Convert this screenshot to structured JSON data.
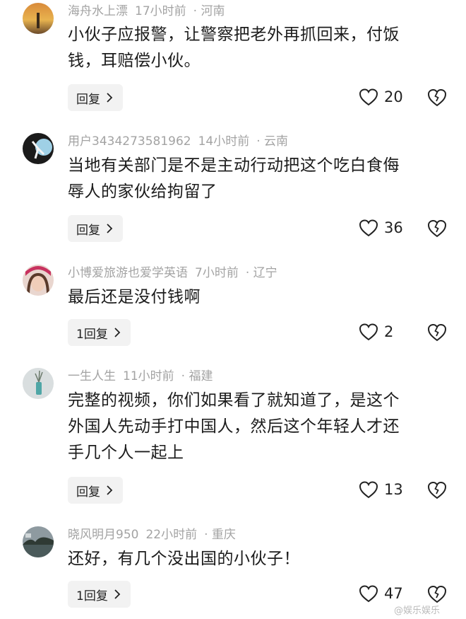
{
  "comments": [
    {
      "username": "海舟水上漂",
      "time": "17小时前",
      "location": "· 河南",
      "lines": [
        "小伙子应报警，让警察把老外再抓回来，付饭",
        "钱，耳赔偿小伙。"
      ],
      "reply_label": "回复",
      "likes": "20"
    },
    {
      "username": "用户3434273581962",
      "time": "14小时前",
      "location": "· 云南",
      "lines": [
        "当地有关部门是不是主动行动把这个吃白食侮",
        "辱人的家伙给拘留了"
      ],
      "reply_label": "回复",
      "likes": "36"
    },
    {
      "username": "小博爱旅游也爱学英语",
      "time": "7小时前",
      "location": "· 辽宁",
      "lines": [
        "最后还是没付钱啊"
      ],
      "reply_label": "1回复",
      "likes": "2"
    },
    {
      "username": "一生人生",
      "time": "11小时前",
      "location": "· 福建",
      "lines": [
        "完整的视频，你们如果看了就知道了，是这个",
        "外国人先动手打中国人，然后这个年轻人才还",
        "手几个人一起上"
      ],
      "reply_label": "回复",
      "likes": "13"
    },
    {
      "username": "晓风明月950",
      "time": "22小时前",
      "location": "· 重庆",
      "lines": [
        "还好，有几个没出国的小伙子！"
      ],
      "reply_label": "1回复",
      "likes": "47"
    }
  ],
  "watermark": "@娱乐娱乐",
  "colors": {
    "meta": "#a3a3a3",
    "reply_bg": "#f2f2f2",
    "text": "#1c1c1c"
  },
  "icons": {
    "like": "heart-outline-icon",
    "dislike": "broken-heart-icon",
    "reply_arrow": "chevron-right-icon"
  }
}
